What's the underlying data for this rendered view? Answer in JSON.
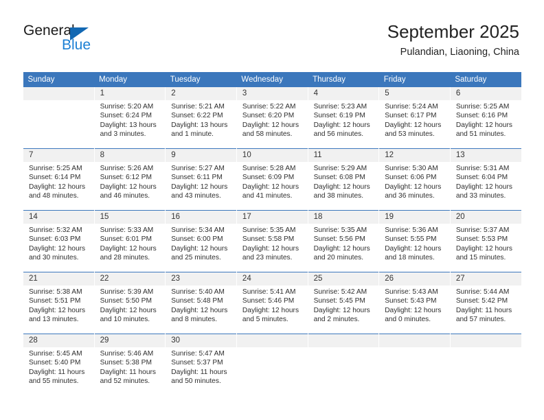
{
  "logo": {
    "primary_text": "General",
    "secondary_text": "Blue",
    "primary_color": "#1a1a1a",
    "secondary_color": "#1b7fd4",
    "triangle_color": "#1268b3"
  },
  "header": {
    "title": "September 2025",
    "subtitle": "Pulandian, Liaoning, China"
  },
  "theme": {
    "header_bg": "#3b77bc",
    "header_text": "#ffffff",
    "daynum_bg": "#f1f1f1",
    "grid_line": "#3b77bc",
    "body_text": "#2e2e2e"
  },
  "weekday_headers": [
    "Sunday",
    "Monday",
    "Tuesday",
    "Wednesday",
    "Thursday",
    "Friday",
    "Saturday"
  ],
  "weeks": [
    [
      {
        "day": "",
        "sunrise": "",
        "sunset": "",
        "daylight_line1": "",
        "daylight_line2": "",
        "blank": true
      },
      {
        "day": "1",
        "sunrise": "Sunrise: 5:20 AM",
        "sunset": "Sunset: 6:24 PM",
        "daylight_line1": "Daylight: 13 hours",
        "daylight_line2": "and 3 minutes."
      },
      {
        "day": "2",
        "sunrise": "Sunrise: 5:21 AM",
        "sunset": "Sunset: 6:22 PM",
        "daylight_line1": "Daylight: 13 hours",
        "daylight_line2": "and 1 minute."
      },
      {
        "day": "3",
        "sunrise": "Sunrise: 5:22 AM",
        "sunset": "Sunset: 6:20 PM",
        "daylight_line1": "Daylight: 12 hours",
        "daylight_line2": "and 58 minutes."
      },
      {
        "day": "4",
        "sunrise": "Sunrise: 5:23 AM",
        "sunset": "Sunset: 6:19 PM",
        "daylight_line1": "Daylight: 12 hours",
        "daylight_line2": "and 56 minutes."
      },
      {
        "day": "5",
        "sunrise": "Sunrise: 5:24 AM",
        "sunset": "Sunset: 6:17 PM",
        "daylight_line1": "Daylight: 12 hours",
        "daylight_line2": "and 53 minutes."
      },
      {
        "day": "6",
        "sunrise": "Sunrise: 5:25 AM",
        "sunset": "Sunset: 6:16 PM",
        "daylight_line1": "Daylight: 12 hours",
        "daylight_line2": "and 51 minutes."
      }
    ],
    [
      {
        "day": "7",
        "sunrise": "Sunrise: 5:25 AM",
        "sunset": "Sunset: 6:14 PM",
        "daylight_line1": "Daylight: 12 hours",
        "daylight_line2": "and 48 minutes."
      },
      {
        "day": "8",
        "sunrise": "Sunrise: 5:26 AM",
        "sunset": "Sunset: 6:12 PM",
        "daylight_line1": "Daylight: 12 hours",
        "daylight_line2": "and 46 minutes."
      },
      {
        "day": "9",
        "sunrise": "Sunrise: 5:27 AM",
        "sunset": "Sunset: 6:11 PM",
        "daylight_line1": "Daylight: 12 hours",
        "daylight_line2": "and 43 minutes."
      },
      {
        "day": "10",
        "sunrise": "Sunrise: 5:28 AM",
        "sunset": "Sunset: 6:09 PM",
        "daylight_line1": "Daylight: 12 hours",
        "daylight_line2": "and 41 minutes."
      },
      {
        "day": "11",
        "sunrise": "Sunrise: 5:29 AM",
        "sunset": "Sunset: 6:08 PM",
        "daylight_line1": "Daylight: 12 hours",
        "daylight_line2": "and 38 minutes."
      },
      {
        "day": "12",
        "sunrise": "Sunrise: 5:30 AM",
        "sunset": "Sunset: 6:06 PM",
        "daylight_line1": "Daylight: 12 hours",
        "daylight_line2": "and 36 minutes."
      },
      {
        "day": "13",
        "sunrise": "Sunrise: 5:31 AM",
        "sunset": "Sunset: 6:04 PM",
        "daylight_line1": "Daylight: 12 hours",
        "daylight_line2": "and 33 minutes."
      }
    ],
    [
      {
        "day": "14",
        "sunrise": "Sunrise: 5:32 AM",
        "sunset": "Sunset: 6:03 PM",
        "daylight_line1": "Daylight: 12 hours",
        "daylight_line2": "and 30 minutes."
      },
      {
        "day": "15",
        "sunrise": "Sunrise: 5:33 AM",
        "sunset": "Sunset: 6:01 PM",
        "daylight_line1": "Daylight: 12 hours",
        "daylight_line2": "and 28 minutes."
      },
      {
        "day": "16",
        "sunrise": "Sunrise: 5:34 AM",
        "sunset": "Sunset: 6:00 PM",
        "daylight_line1": "Daylight: 12 hours",
        "daylight_line2": "and 25 minutes."
      },
      {
        "day": "17",
        "sunrise": "Sunrise: 5:35 AM",
        "sunset": "Sunset: 5:58 PM",
        "daylight_line1": "Daylight: 12 hours",
        "daylight_line2": "and 23 minutes."
      },
      {
        "day": "18",
        "sunrise": "Sunrise: 5:35 AM",
        "sunset": "Sunset: 5:56 PM",
        "daylight_line1": "Daylight: 12 hours",
        "daylight_line2": "and 20 minutes."
      },
      {
        "day": "19",
        "sunrise": "Sunrise: 5:36 AM",
        "sunset": "Sunset: 5:55 PM",
        "daylight_line1": "Daylight: 12 hours",
        "daylight_line2": "and 18 minutes."
      },
      {
        "day": "20",
        "sunrise": "Sunrise: 5:37 AM",
        "sunset": "Sunset: 5:53 PM",
        "daylight_line1": "Daylight: 12 hours",
        "daylight_line2": "and 15 minutes."
      }
    ],
    [
      {
        "day": "21",
        "sunrise": "Sunrise: 5:38 AM",
        "sunset": "Sunset: 5:51 PM",
        "daylight_line1": "Daylight: 12 hours",
        "daylight_line2": "and 13 minutes."
      },
      {
        "day": "22",
        "sunrise": "Sunrise: 5:39 AM",
        "sunset": "Sunset: 5:50 PM",
        "daylight_line1": "Daylight: 12 hours",
        "daylight_line2": "and 10 minutes."
      },
      {
        "day": "23",
        "sunrise": "Sunrise: 5:40 AM",
        "sunset": "Sunset: 5:48 PM",
        "daylight_line1": "Daylight: 12 hours",
        "daylight_line2": "and 8 minutes."
      },
      {
        "day": "24",
        "sunrise": "Sunrise: 5:41 AM",
        "sunset": "Sunset: 5:46 PM",
        "daylight_line1": "Daylight: 12 hours",
        "daylight_line2": "and 5 minutes."
      },
      {
        "day": "25",
        "sunrise": "Sunrise: 5:42 AM",
        "sunset": "Sunset: 5:45 PM",
        "daylight_line1": "Daylight: 12 hours",
        "daylight_line2": "and 2 minutes."
      },
      {
        "day": "26",
        "sunrise": "Sunrise: 5:43 AM",
        "sunset": "Sunset: 5:43 PM",
        "daylight_line1": "Daylight: 12 hours",
        "daylight_line2": "and 0 minutes."
      },
      {
        "day": "27",
        "sunrise": "Sunrise: 5:44 AM",
        "sunset": "Sunset: 5:42 PM",
        "daylight_line1": "Daylight: 11 hours",
        "daylight_line2": "and 57 minutes."
      }
    ],
    [
      {
        "day": "28",
        "sunrise": "Sunrise: 5:45 AM",
        "sunset": "Sunset: 5:40 PM",
        "daylight_line1": "Daylight: 11 hours",
        "daylight_line2": "and 55 minutes."
      },
      {
        "day": "29",
        "sunrise": "Sunrise: 5:46 AM",
        "sunset": "Sunset: 5:38 PM",
        "daylight_line1": "Daylight: 11 hours",
        "daylight_line2": "and 52 minutes."
      },
      {
        "day": "30",
        "sunrise": "Sunrise: 5:47 AM",
        "sunset": "Sunset: 5:37 PM",
        "daylight_line1": "Daylight: 11 hours",
        "daylight_line2": "and 50 minutes."
      },
      {
        "day": "",
        "sunrise": "",
        "sunset": "",
        "daylight_line1": "",
        "daylight_line2": "",
        "blank": true
      },
      {
        "day": "",
        "sunrise": "",
        "sunset": "",
        "daylight_line1": "",
        "daylight_line2": "",
        "blank": true
      },
      {
        "day": "",
        "sunrise": "",
        "sunset": "",
        "daylight_line1": "",
        "daylight_line2": "",
        "blank": true
      },
      {
        "day": "",
        "sunrise": "",
        "sunset": "",
        "daylight_line1": "",
        "daylight_line2": "",
        "blank": true
      }
    ]
  ]
}
